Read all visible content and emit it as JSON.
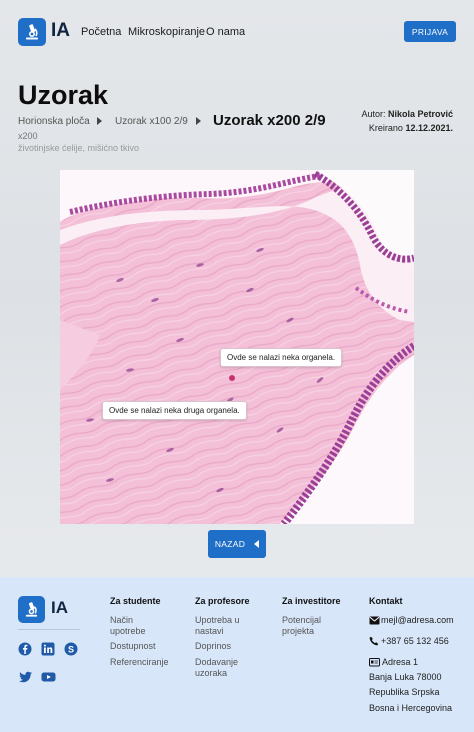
{
  "header": {
    "logo_text": "IA",
    "nav": [
      "Početna",
      "Mikroskopiranje",
      "O nama"
    ],
    "login_label": "PRIJAVA"
  },
  "page": {
    "title": "Uzorak",
    "breadcrumb": [
      "Horionska ploča",
      "Uzorak x100 2/9"
    ],
    "current": "Uzorak x200 2/9",
    "magnification": "x200",
    "subtitle": "životinjske ćelije, mišićno tkivo",
    "author_label": "Autor:",
    "author_name": "Nikola Petrović",
    "created_label": "Kreirano",
    "created_date": "12.12.2021."
  },
  "annotations": [
    "Ovde se nalazi neka organela.",
    "Ovde se nalazi neka druga organela."
  ],
  "back_label": "NAZAD",
  "footer": {
    "logo_text": "IA",
    "columns": [
      {
        "heading": "Za studente",
        "links": [
          "Način upotrebe",
          "Dostupnost",
          "Referenciranje"
        ]
      },
      {
        "heading": "Za profesore",
        "links": [
          "Upotreba u nastavi",
          "Doprinos",
          "Dodavanje uzoraka"
        ]
      },
      {
        "heading": "Za investitore",
        "links": [
          "Potencijal projekta"
        ]
      }
    ],
    "contact": {
      "heading": "Kontakt",
      "email": "mejl@adresa.com",
      "phone": "+387 65 132 456",
      "address": [
        "Adresa 1",
        "Banja Luka 78000",
        "Republika Srpska",
        "Bosna i Hercegovina"
      ]
    },
    "social": [
      "facebook-icon",
      "linkedin-icon",
      "skype-icon",
      "twitter-icon",
      "youtube-icon"
    ]
  },
  "colors": {
    "primary": "#1f6ec7",
    "footer_bg": "#d7e6f9",
    "tissue_pink": "#f2b6d1",
    "nuclei": "#8d3b8c"
  }
}
